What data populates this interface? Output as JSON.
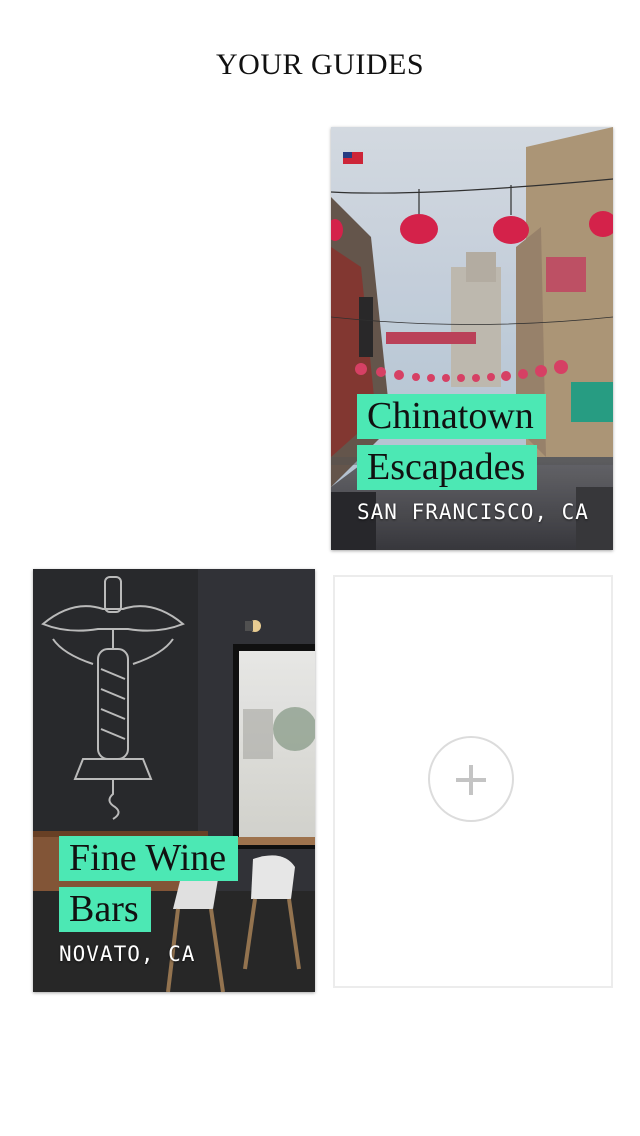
{
  "header": {
    "title": "YOUR GUIDES"
  },
  "guides": [
    {
      "title_line1": "Chinatown",
      "title_line2": "Escapades",
      "location": "SAN FRANCISCO, CA"
    },
    {
      "title_line1": "Fine Wine",
      "title_line2": "Bars",
      "location": "NOVATO, CA"
    }
  ],
  "add_guide": {
    "icon": "plus-icon"
  },
  "colors": {
    "highlight": "#4ce8b4",
    "background": "#ffffff",
    "title_text": "#111111",
    "location_text": "#ffffff",
    "add_border": "#ececec",
    "plus": "#c4c4c4"
  }
}
